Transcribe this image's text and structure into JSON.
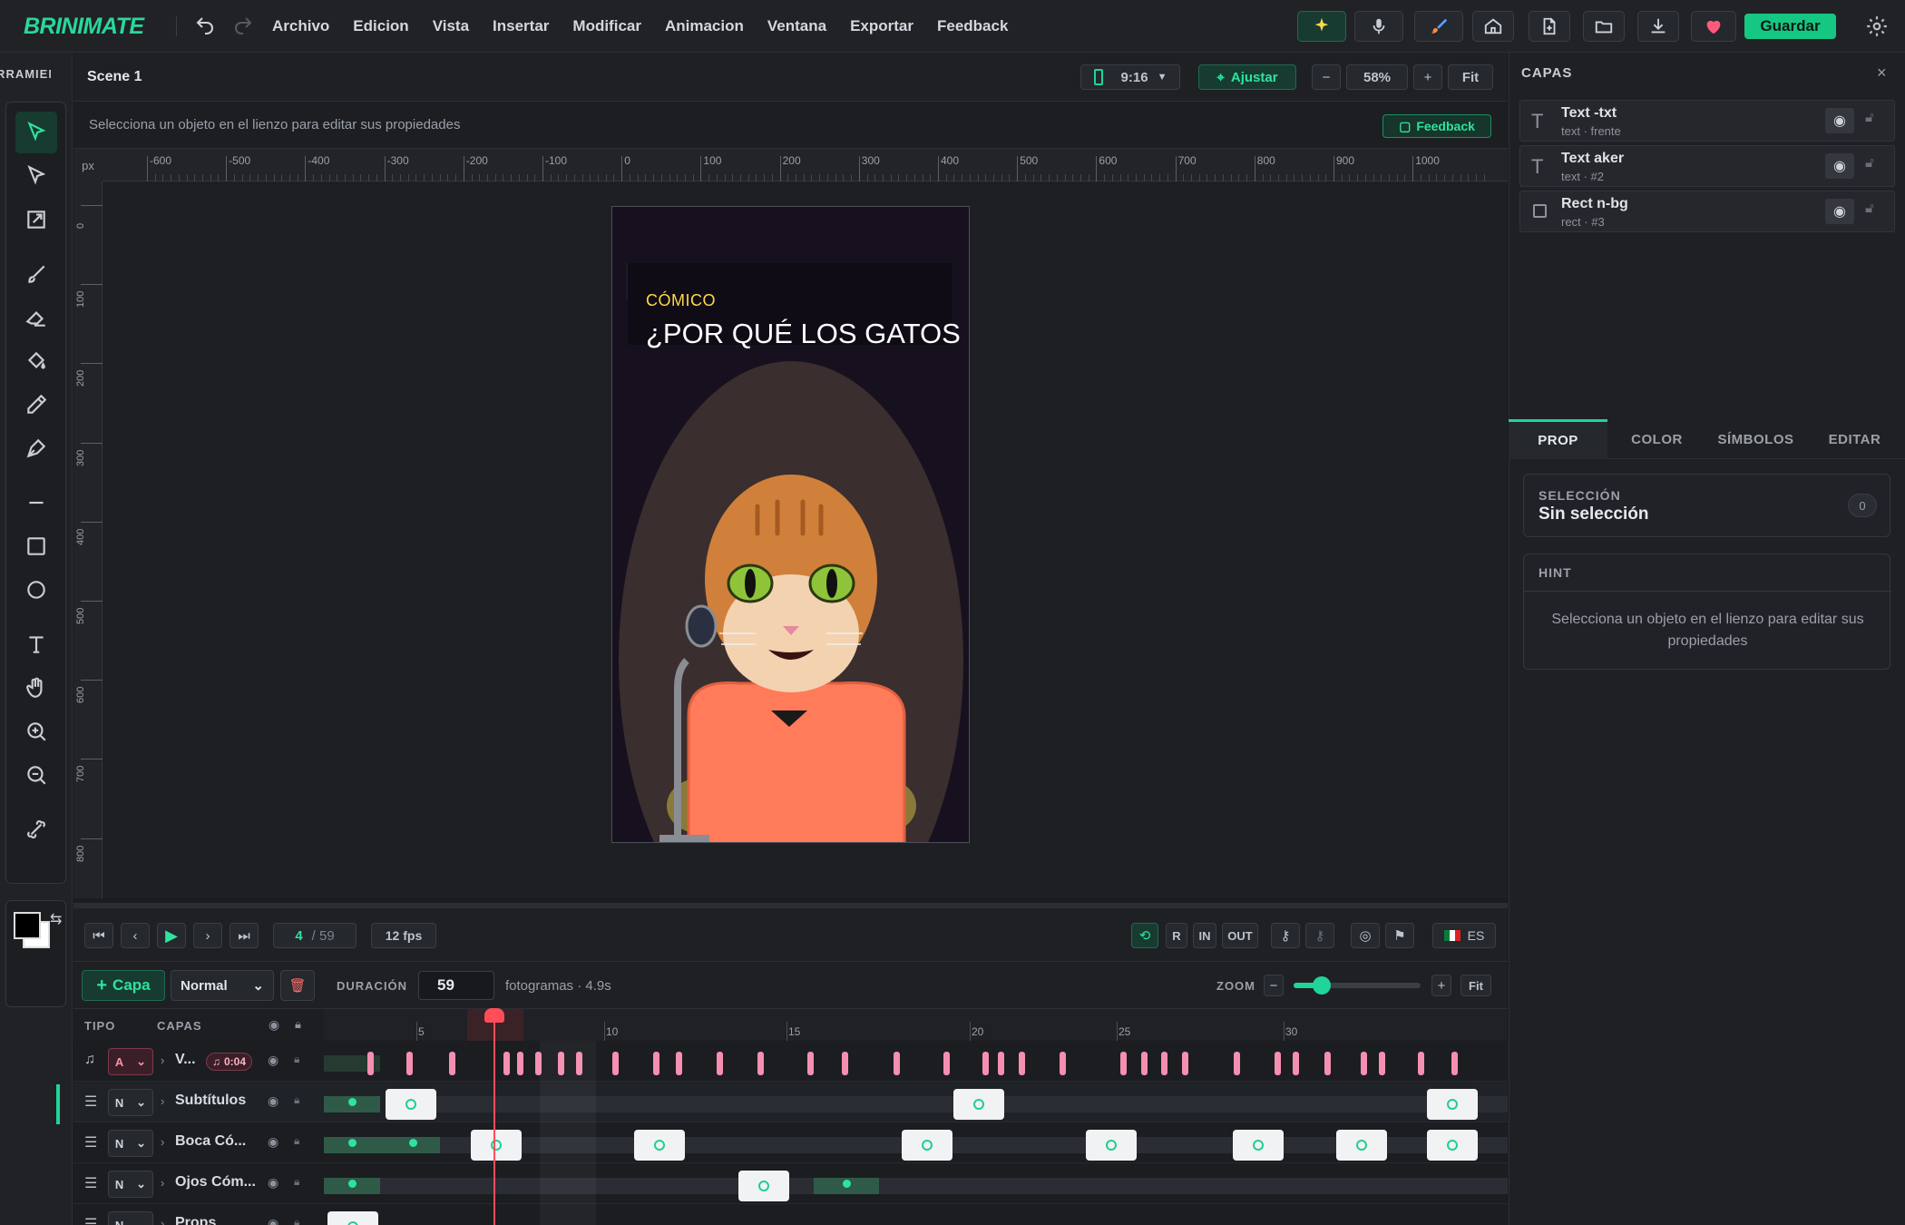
{
  "app": {
    "brand": "BRINIMATE"
  },
  "menu": [
    "Archivo",
    "Edicion",
    "Vista",
    "Insertar",
    "Modificar",
    "Animacion",
    "Ventana",
    "Exportar",
    "Feedback"
  ],
  "toolbar": {
    "save_label": "Guardar"
  },
  "tools": {
    "heading": "HERRAMIENTAS"
  },
  "scene": {
    "name": "Scene 1",
    "ratio": "9:16",
    "fit_btn": "Ajustar",
    "zoom": "58%",
    "fit": "Fit"
  },
  "hint": {
    "text": "Selecciona un objeto en el lienzo para editar sus propiedades",
    "feedback": "Feedback"
  },
  "ruler": {
    "unit": "px",
    "top": [
      "-600",
      "-500",
      "-400",
      "-300",
      "-200",
      "-100",
      "0",
      "100",
      "200",
      "300",
      "400",
      "500",
      "600",
      "700",
      "800",
      "900",
      "1000"
    ],
    "left": [
      "0",
      "100",
      "200",
      "300",
      "400",
      "500",
      "600",
      "700",
      "800"
    ]
  },
  "artboard": {
    "tag": "CÓMICO",
    "headline": "¿POR QUÉ LOS GATOS"
  },
  "layers_panel": {
    "title": "CAPAS",
    "layers": [
      {
        "name": "Text -txt",
        "sub": "text · frente"
      },
      {
        "name": "Text aker",
        "sub": "text · #2"
      },
      {
        "name": "Rect n-bg",
        "sub": "rect · #3"
      }
    ]
  },
  "tabs": [
    "PROP",
    "COLOR",
    "SÍMBOLOS",
    "EDITAR"
  ],
  "selection": {
    "label": "SELECCIÓN",
    "value": "Sin selección",
    "count": "0"
  },
  "hintcard": {
    "label": "HINT",
    "text": "Selecciona un objeto en el lienzo para editar sus propiedades"
  },
  "playback": {
    "frame": "4",
    "total": "/ 59",
    "fps": "12 fps",
    "r": "R",
    "in": "IN",
    "out": "OUT",
    "lang": "ES"
  },
  "timeline": {
    "add_layer": "Capa",
    "blend": "Normal",
    "duration_label": "DURACIÓN",
    "duration": "59",
    "duration_unit": "fotogramas · 4.9s",
    "zoom_label": "ZOOM",
    "zoom_fit": "Fit",
    "zoom_value": 0.22,
    "col_type": "TIPO",
    "col_layers": "CAPAS",
    "frame_ticks": [
      "5",
      "10",
      "15",
      "20",
      "25",
      "30"
    ]
  },
  "tracks": [
    {
      "type": "A",
      "name": "V...",
      "badge": "0:04"
    },
    {
      "type": "N",
      "name": "Subtítulos"
    },
    {
      "type": "N",
      "name": "Boca Có..."
    },
    {
      "type": "N",
      "name": "Ojos Cóm..."
    },
    {
      "type": "N",
      "name": "Props"
    }
  ],
  "colors": {
    "accent": "#1fd59a",
    "save": "#16c784",
    "marker": "#f48fb1",
    "playhead": "#ff4d5a"
  }
}
